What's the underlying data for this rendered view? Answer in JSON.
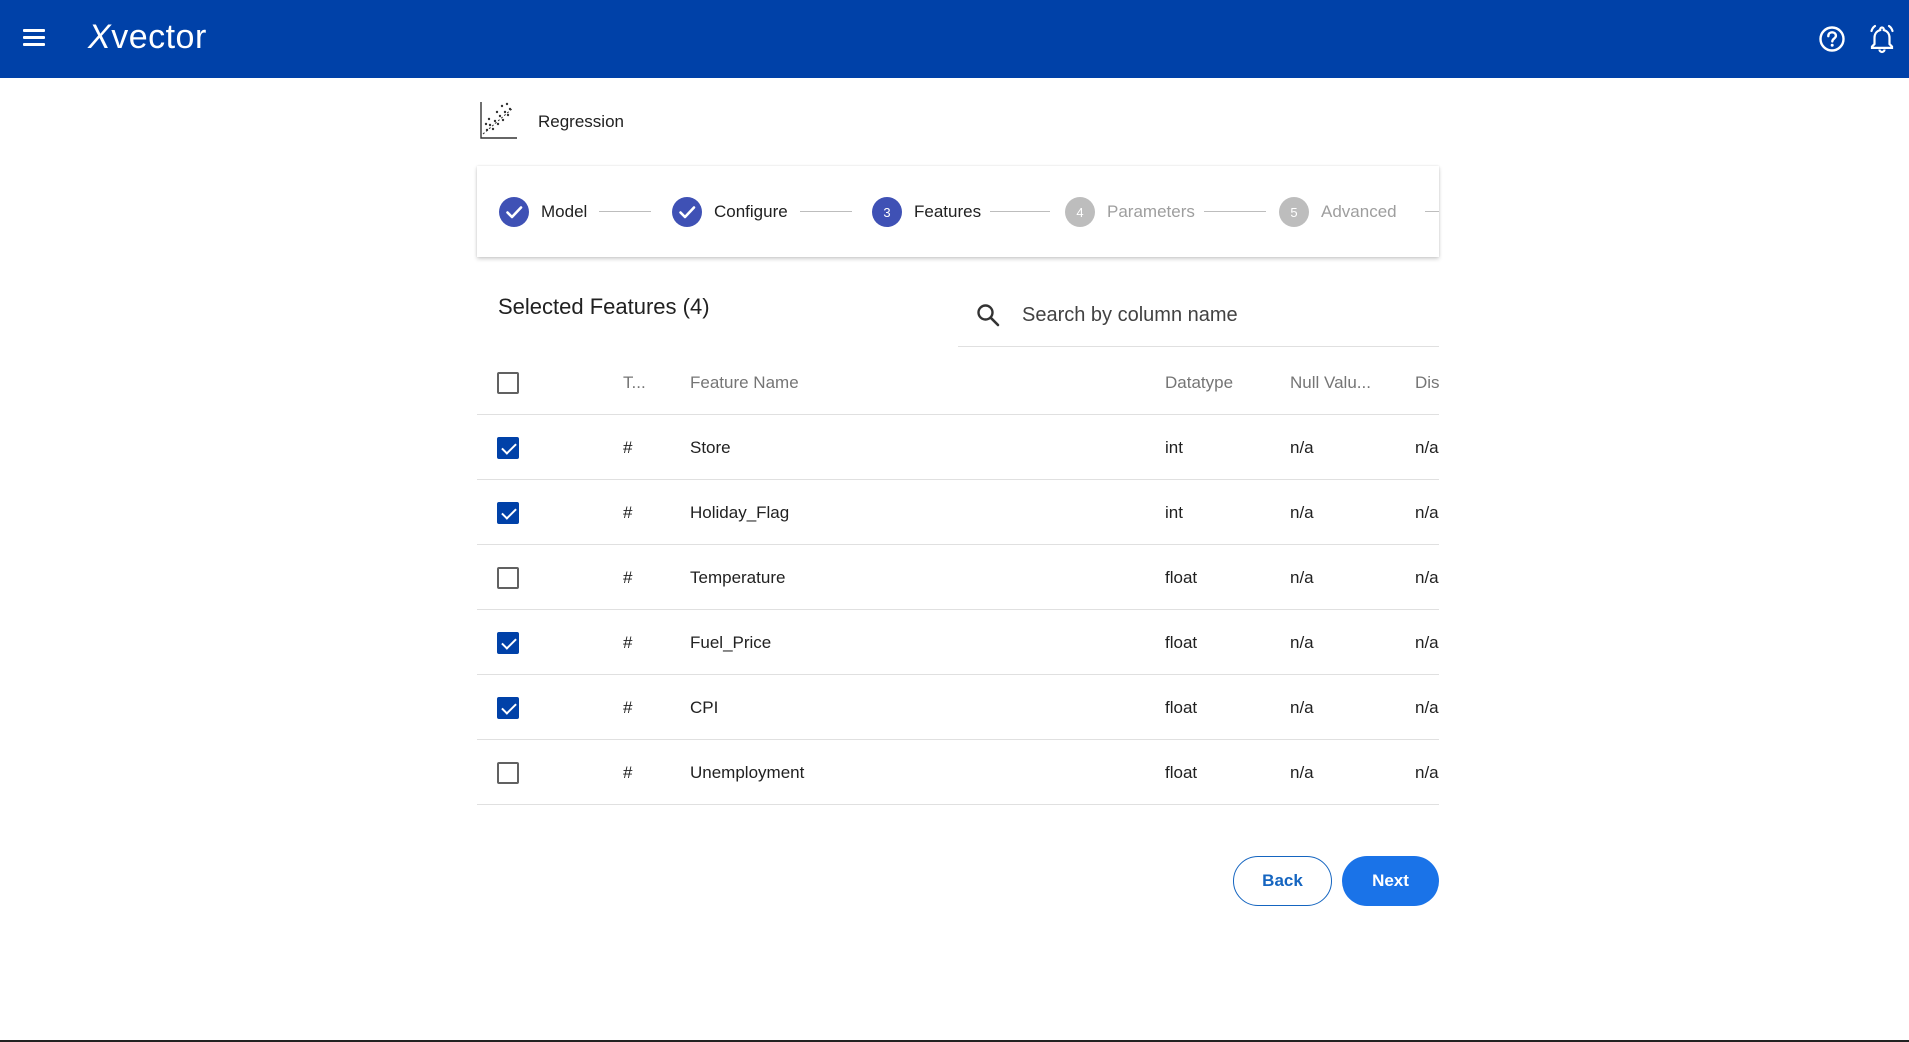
{
  "app": {
    "brand": "Xvector",
    "icons": {
      "menu": "hamburger-menu-icon",
      "help": "help-circle-icon",
      "notifications": "bell-icon"
    },
    "colors": {
      "topbar": "#0041a8",
      "accent": "#3f51b5",
      "primary_button": "#1a73e8",
      "checkbox_on": "#0041a8"
    }
  },
  "page": {
    "title": "Regression",
    "icon": "scatter-plot-icon"
  },
  "stepper": {
    "steps": [
      {
        "number": "1",
        "label": "Model",
        "state": "done"
      },
      {
        "number": "2",
        "label": "Configure",
        "state": "done"
      },
      {
        "number": "3",
        "label": "Features",
        "state": "active"
      },
      {
        "number": "4",
        "label": "Parameters",
        "state": "todo"
      },
      {
        "number": "5",
        "label": "Advanced",
        "state": "todo"
      }
    ]
  },
  "features": {
    "title": "Selected Features (4)",
    "search_placeholder": "Search by column name",
    "columns": [
      "T...",
      "Feature Name",
      "Datatype",
      "Null Valu...",
      "Dis"
    ],
    "rows": [
      {
        "checked": true,
        "type": "#",
        "name": "Store",
        "datatype": "int",
        "null": "n/a",
        "dis": "n/a"
      },
      {
        "checked": true,
        "type": "#",
        "name": "Holiday_Flag",
        "datatype": "int",
        "null": "n/a",
        "dis": "n/a"
      },
      {
        "checked": false,
        "type": "#",
        "name": "Temperature",
        "datatype": "float",
        "null": "n/a",
        "dis": "n/a"
      },
      {
        "checked": true,
        "type": "#",
        "name": "Fuel_Price",
        "datatype": "float",
        "null": "n/a",
        "dis": "n/a"
      },
      {
        "checked": true,
        "type": "#",
        "name": "CPI",
        "datatype": "float",
        "null": "n/a",
        "dis": "n/a"
      },
      {
        "checked": false,
        "type": "#",
        "name": "Unemployment",
        "datatype": "float",
        "null": "n/a",
        "dis": "n/a"
      }
    ]
  },
  "actions": {
    "back": "Back",
    "next": "Next"
  }
}
